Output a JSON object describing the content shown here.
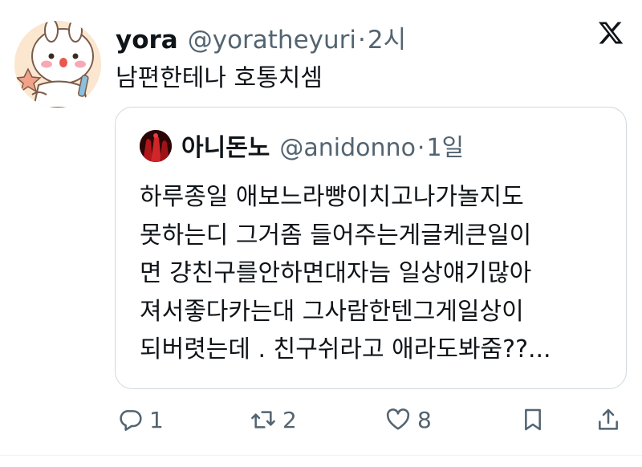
{
  "tweet": {
    "author_name": "yora",
    "author_handle": "@yoratheyuri",
    "separator": "·",
    "time": "2시",
    "text": "남편한테나 호통치셈"
  },
  "quote": {
    "author_name": "아니돈노",
    "author_handle": "@anidonno",
    "separator": "·",
    "time": "1일",
    "lines": [
      "하루종일 애보느라빵이치고나가놀지도",
      "못하는디 그거좀 들어주는게글케큰일이",
      "면 걍친구를안하면대자늠 일상얘기많아",
      "져서좋다카는대 그사람한텐그게일상이",
      "되버렷는데 . 친구쉬라고 애라도봐줌??..."
    ]
  },
  "actions": {
    "replies": "1",
    "reposts": "2",
    "likes": "8"
  },
  "icons": {
    "logo": "x-logo-icon",
    "reply": "reply-icon",
    "repost": "repost-icon",
    "like": "heart-icon",
    "bookmark": "bookmark-icon",
    "share": "share-icon"
  },
  "colors": {
    "text": "#0f1419",
    "secondary": "#536471",
    "border": "#cfd9de"
  }
}
